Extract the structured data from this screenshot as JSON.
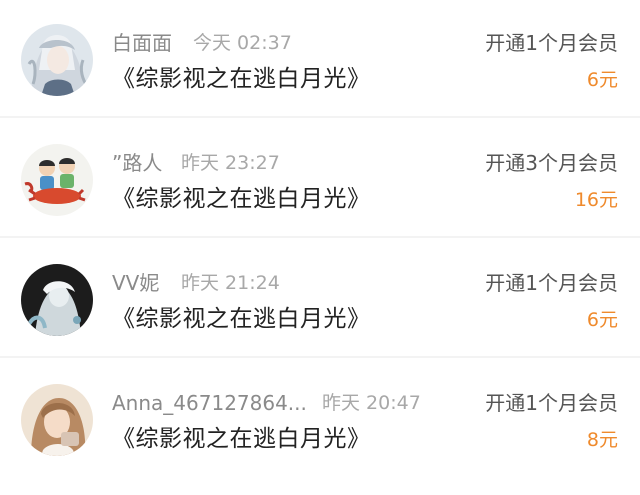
{
  "records": [
    {
      "avatar": "avatar-silver-hair-character",
      "name": "白面面",
      "time": "今天 02:37",
      "title": "《综影视之在逃白月光》",
      "plan": "开通1个月会员",
      "price": "6元"
    },
    {
      "avatar": "avatar-cartoon-kids-on-lobster",
      "name": "”路人",
      "time": "昨天 23:27",
      "title": "《综影视之在逃白月光》",
      "plan": "开通3个月会员",
      "price": "16元"
    },
    {
      "avatar": "avatar-white-figure-dark-background",
      "name": "VV妮",
      "time": "昨天 21:24",
      "title": "《综影视之在逃白月光》",
      "plan": "开通1个月会员",
      "price": "6元"
    },
    {
      "avatar": "avatar-girl-photo",
      "name": "Anna_467127864...",
      "time": "昨天 20:47",
      "title": "《综影视之在逃白月光》",
      "plan": "开通1个月会员",
      "price": "8元"
    }
  ],
  "colors": {
    "price": "#ef8a2c",
    "name": "#8a8a8a",
    "time": "#a8a8a8",
    "title": "#222222",
    "plan": "#555555"
  }
}
